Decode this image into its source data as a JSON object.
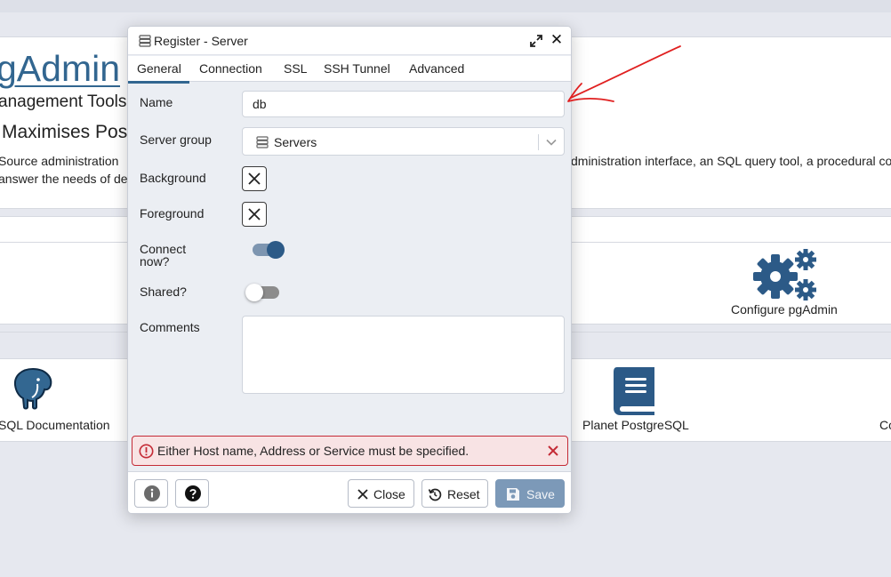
{
  "background": {
    "app_title": "gAdmin",
    "subtitle": "anagement Tools f",
    "subtitle2": "Maximises Pos",
    "desc_left_1": "Source administration",
    "desc_left_2": "answer the needs of de",
    "desc_right_1": "dministration interface, an SQL query tool, a procedural cod",
    "links": {
      "configure": "Configure pgAdmin",
      "pg_docs": "SQL Documentation",
      "planet": "Planet PostgreSQL",
      "community": "Co"
    }
  },
  "dialog": {
    "title": "Register - Server",
    "tabs": [
      "General",
      "Connection",
      "SSL",
      "SSH Tunnel",
      "Advanced"
    ],
    "active_tab": "General",
    "fields": {
      "name_label": "Name",
      "name_value": "db",
      "server_group_label": "Server group",
      "server_group_value": "Servers",
      "background_label": "Background",
      "foreground_label": "Foreground",
      "connect_now_label_1": "Connect",
      "connect_now_label_2": "now?",
      "connect_now": true,
      "shared_label": "Shared?",
      "shared": false,
      "comments_label": "Comments",
      "comments_value": ""
    },
    "error": {
      "message": "Either Host name, Address or Service must be specified."
    },
    "footer": {
      "close_label": "Close",
      "reset_label": "Reset",
      "save_label": "Save"
    }
  },
  "colors": {
    "accent": "#326690",
    "save_disabled": "#7c99b8",
    "error_border": "#c42b36",
    "error_bg": "#f8e3e4",
    "annotation": "#e02020"
  }
}
